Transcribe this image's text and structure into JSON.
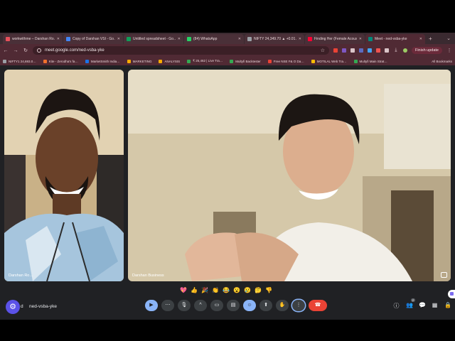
{
  "browser": {
    "tabs": [
      {
        "label": "workwithme – Darshan Ro…",
        "favicon_color": "#e8505b"
      },
      {
        "label": "Copy of Darshan VSI - Go…",
        "favicon_color": "#4285f4"
      },
      {
        "label": "Untitled spreadsheet - Go…",
        "favicon_color": "#0f9d58"
      },
      {
        "label": "(84) WhatsApp",
        "favicon_color": "#25d366"
      },
      {
        "label": "NIFTY 24,349.70 ▲ +0.01…",
        "favicon_color": "#9aa0a6"
      },
      {
        "label": "Finding Her (Female Acous…",
        "favicon_color": "#ff0033"
      },
      {
        "label": "Meet - ned-vsba-yke",
        "favicon_color": "#00897b",
        "active": true
      }
    ],
    "new_tab_label": "+",
    "url": "meet.google.com/ned-vsba-yke",
    "finish_update_label": "Finish update",
    "bookmarks": [
      {
        "label": "NIFTY1 24,693.0…",
        "color": "#9aa0a6"
      },
      {
        "label": "Kite - Zerodha's fa…",
        "color": "#f0712c"
      },
      {
        "label": "MarketSmith India…",
        "color": "#1a73e8"
      },
      {
        "label": "MARKETING",
        "color": "#f9ab00"
      },
      {
        "label": "ANALYSIS",
        "color": "#f9ab00"
      },
      {
        "label": "₹ 25,462 | Live Tra…",
        "color": "#34a853"
      },
      {
        "label": "Multyfi Backtester",
        "color": "#34a853"
      },
      {
        "label": "Free NSE F& O Da…",
        "color": "#ea4335"
      },
      {
        "label": "MOTILAL Web Tra…",
        "color": "#fbbc04"
      },
      {
        "label": "Multyfi Main Strat…",
        "color": "#34a853"
      }
    ],
    "all_bookmarks_label": "All Bookmarks"
  },
  "meeting": {
    "code": "ned-vsba-yke",
    "code_prefix": "d",
    "participants": [
      {
        "name": "Darshan Ro…"
      },
      {
        "name": "Darshan Business"
      }
    ],
    "reactions": [
      "💖",
      "👍",
      "🎉",
      "👏",
      "😂",
      "😮",
      "😢",
      "🤔",
      "👎"
    ],
    "controls": [
      {
        "name": "send-reaction-button",
        "glyph": "▶"
      },
      {
        "name": "audio-settings-button",
        "glyph": "⋯"
      },
      {
        "name": "mic-button",
        "glyph": "🎙"
      },
      {
        "name": "mic-options-button",
        "glyph": "^"
      },
      {
        "name": "camera-button",
        "glyph": "▭"
      },
      {
        "name": "captions-button",
        "glyph": "▤"
      },
      {
        "name": "emoji-button",
        "glyph": "☺"
      },
      {
        "name": "present-button",
        "glyph": "⬆"
      },
      {
        "name": "raise-hand-button",
        "glyph": "✋"
      },
      {
        "name": "more-options-button",
        "glyph": "⋮"
      },
      {
        "name": "leave-call-button",
        "glyph": "☎"
      }
    ],
    "right_controls": [
      {
        "name": "info-icon",
        "glyph": "ⓘ"
      },
      {
        "name": "people-icon",
        "glyph": "👥",
        "badge": "2"
      },
      {
        "name": "chat-icon",
        "glyph": "💬"
      },
      {
        "name": "activities-icon",
        "glyph": "▦"
      },
      {
        "name": "host-controls-icon",
        "glyph": "🔒"
      }
    ]
  }
}
